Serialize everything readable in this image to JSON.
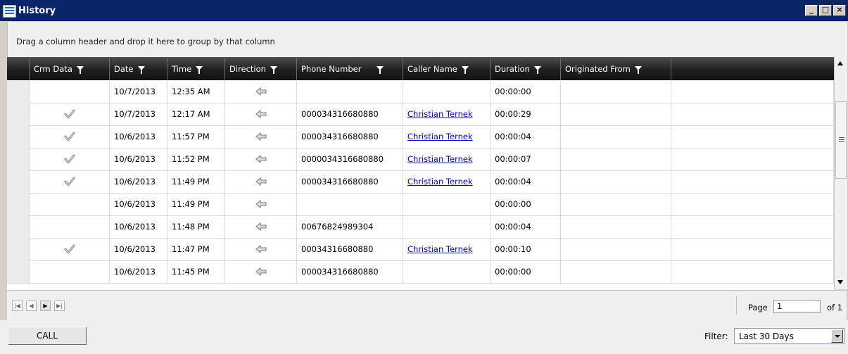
{
  "window": {
    "title": "History"
  },
  "group_panel": {
    "hint": "Drag a column header and drop it here to group by that column"
  },
  "columns": [
    "Crm Data",
    "Date",
    "Time",
    "Direction",
    "Phone Number",
    "Caller Name",
    "Duration",
    "Originated From"
  ],
  "rows": [
    {
      "crm": false,
      "date": "10/7/2013",
      "time": "12:35 AM",
      "direction": "incoming-arrow-icon",
      "phone": "",
      "caller": "",
      "duration": "00:00:00",
      "origin": ""
    },
    {
      "crm": true,
      "date": "10/7/2013",
      "time": "12:17 AM",
      "direction": "incoming-arrow-icon",
      "phone": "000034316680880",
      "caller": "Christian Ternek",
      "duration": "00:00:29",
      "origin": ""
    },
    {
      "crm": true,
      "date": "10/6/2013",
      "time": "11:57 PM",
      "direction": "incoming-arrow-icon",
      "phone": "000034316680880",
      "caller": "Christian Ternek",
      "duration": "00:00:04",
      "origin": ""
    },
    {
      "crm": true,
      "date": "10/6/2013",
      "time": "11:52 PM",
      "direction": "incoming-arrow-icon",
      "phone": "0000034316680880",
      "caller": "Christian Ternek",
      "duration": "00:00:07",
      "origin": ""
    },
    {
      "crm": true,
      "date": "10/6/2013",
      "time": "11:49 PM",
      "direction": "incoming-arrow-icon",
      "phone": "000034316680880",
      "caller": "Christian Ternek",
      "duration": "00:00:04",
      "origin": ""
    },
    {
      "crm": false,
      "date": "10/6/2013",
      "time": "11:49 PM",
      "direction": "incoming-arrow-icon",
      "phone": "",
      "caller": "",
      "duration": "00:00:00",
      "origin": ""
    },
    {
      "crm": false,
      "date": "10/6/2013",
      "time": "11:48 PM",
      "direction": "incoming-arrow-icon",
      "phone": "00676824989304",
      "caller": "",
      "duration": "00:00:04",
      "origin": ""
    },
    {
      "crm": true,
      "date": "10/6/2013",
      "time": "11:47 PM",
      "direction": "incoming-arrow-icon",
      "phone": "00034316680880",
      "caller": "Christian Ternek",
      "duration": "00:00:10",
      "origin": ""
    },
    {
      "crm": false,
      "date": "10/6/2013",
      "time": "11:45 PM",
      "direction": "incoming-arrow-icon",
      "phone": "000034316680880",
      "caller": "",
      "duration": "00:00:00",
      "origin": ""
    }
  ],
  "pager": {
    "page_label": "Page",
    "page_value": "1",
    "of_label": "of 1"
  },
  "actions": {
    "call_label": "CALL"
  },
  "filter": {
    "label": "Filter:",
    "selected": "Last 30 Days"
  },
  "colors": {
    "titlebar": "#0a246a",
    "header": "#1f1f1f",
    "link": "#0000cc"
  }
}
